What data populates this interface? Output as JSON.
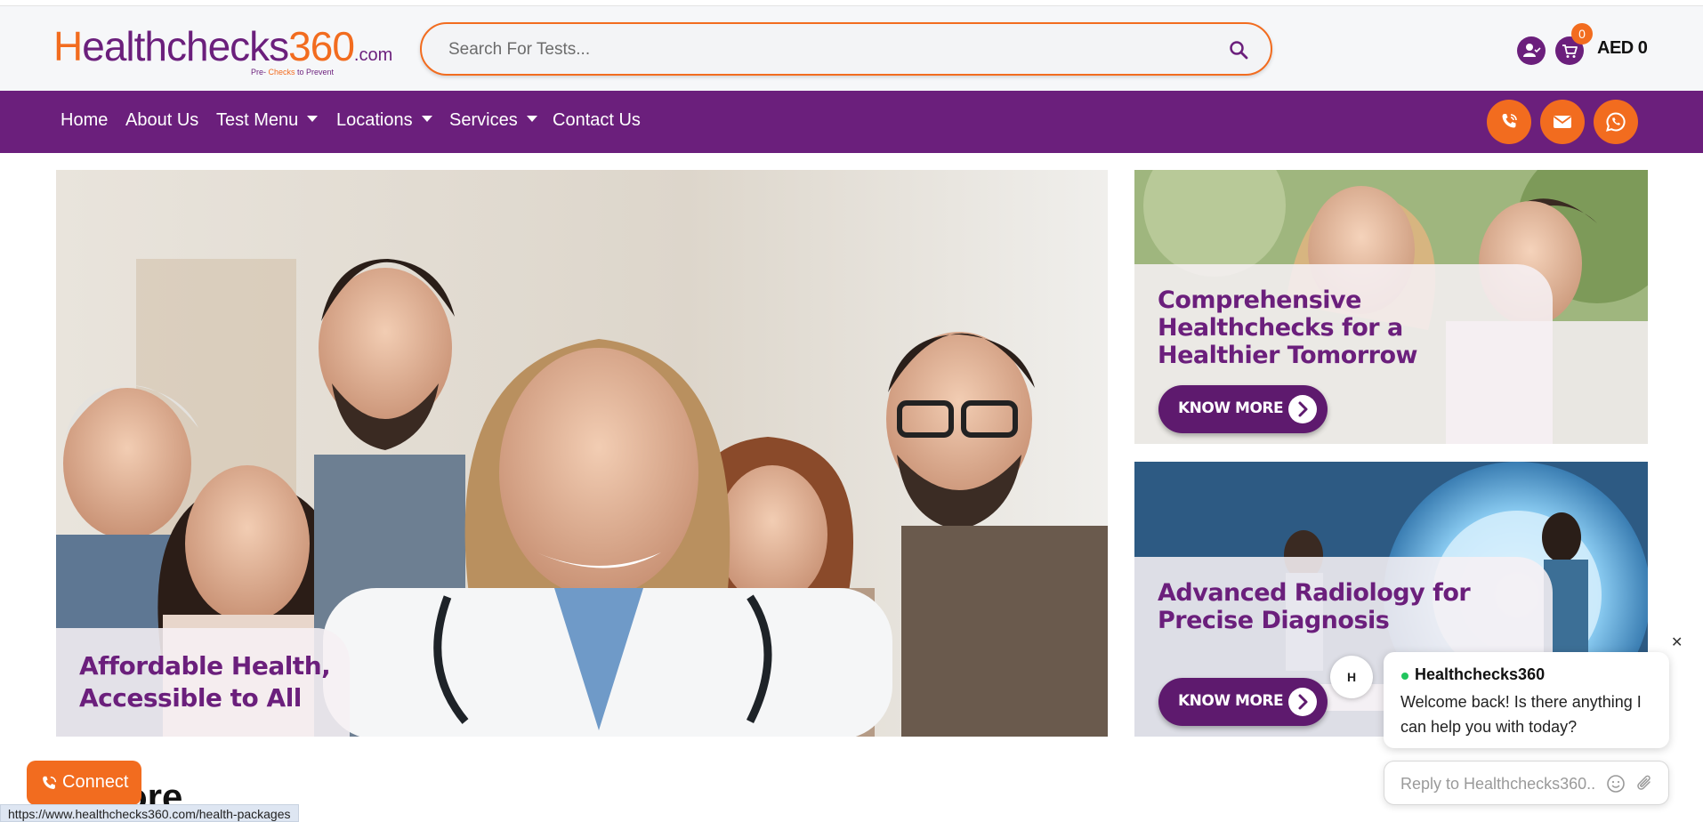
{
  "brand": {
    "logo_h": "H",
    "logo_rest": "ealthchecks",
    "logo_num": "360",
    "logo_com": ".com",
    "tag_1": "Pre- ",
    "tag_2": "Checks",
    "tag_3": " to Prevent"
  },
  "search": {
    "placeholder": "Search For Tests..."
  },
  "header": {
    "cart_count": "0",
    "cart_total": "AED 0"
  },
  "nav": {
    "items": [
      {
        "label": "Home"
      },
      {
        "label": "About Us"
      },
      {
        "label": "Test Menu"
      },
      {
        "label": "Locations"
      },
      {
        "label": "Services"
      },
      {
        "label": "Contact Us"
      }
    ]
  },
  "hero": {
    "main_title": "Affordable Health, Accessible to All",
    "side1_title": "Comprehensive Healthchecks for a Healthier Tomorrow",
    "side1_button": "KNOW MORE",
    "side2_title": "Advanced Radiology for Precise Diagnosis",
    "side2_button": "KNOW MORE"
  },
  "below": {
    "heading_fragment": "ore"
  },
  "connect": {
    "label": "Connect"
  },
  "status_url": "https://www.healthchecks360.com/health-packages",
  "chat": {
    "avatar": "H",
    "name": "Healthchecks360",
    "message": "Welcome back! Is there anything I can help you with today?",
    "placeholder": "Reply to Healthchecks360...",
    "close": "✕"
  },
  "colors": {
    "brand_purple": "#6b1f7c",
    "brand_orange": "#f26c1f",
    "online_green": "#22c55e"
  }
}
